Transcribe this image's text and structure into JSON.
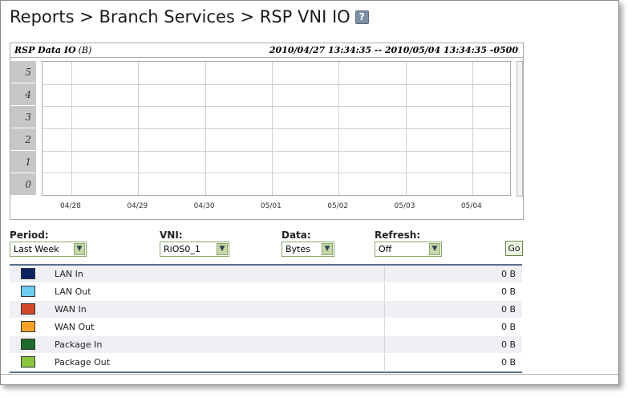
{
  "title": {
    "text": "Reports > Branch Services > RSP VNI IO",
    "help_glyph": "?"
  },
  "chart": {
    "title": "RSP Data IO",
    "unit": "(B)",
    "range": "2010/04/27 13:34:35 -- 2010/05/04 13:34:35 -0500"
  },
  "chart_data": {
    "type": "line",
    "title": "RSP Data IO",
    "ylabel": "(B)",
    "y_ticks": [
      "0",
      "1",
      "2",
      "3",
      "4",
      "5"
    ],
    "ylim": [
      0,
      5
    ],
    "x_tick_labels": [
      "04/28",
      "04/29",
      "04/30",
      "05/01",
      "05/02",
      "05/03",
      "05/04"
    ],
    "grid": true,
    "series": []
  },
  "controls": {
    "period": {
      "label": "Period:",
      "value": "Last Week"
    },
    "vni": {
      "label": "VNI:",
      "value": "RiOS0_1"
    },
    "data": {
      "label": "Data:",
      "value": "Bytes"
    },
    "refresh": {
      "label": "Refresh:",
      "value": "Off"
    },
    "go_label": "Go"
  },
  "legend": [
    {
      "name": "LAN In",
      "color": "#0a2260",
      "value": "0 B"
    },
    {
      "name": "LAN Out",
      "color": "#6fcdf0",
      "value": "0 B"
    },
    {
      "name": "WAN In",
      "color": "#d2492a",
      "value": "0 B"
    },
    {
      "name": "WAN Out",
      "color": "#f4a326",
      "value": "0 B"
    },
    {
      "name": "Package In",
      "color": "#1e6b2e",
      "value": "0 B"
    },
    {
      "name": "Package Out",
      "color": "#8dc63f",
      "value": "0 B"
    }
  ]
}
